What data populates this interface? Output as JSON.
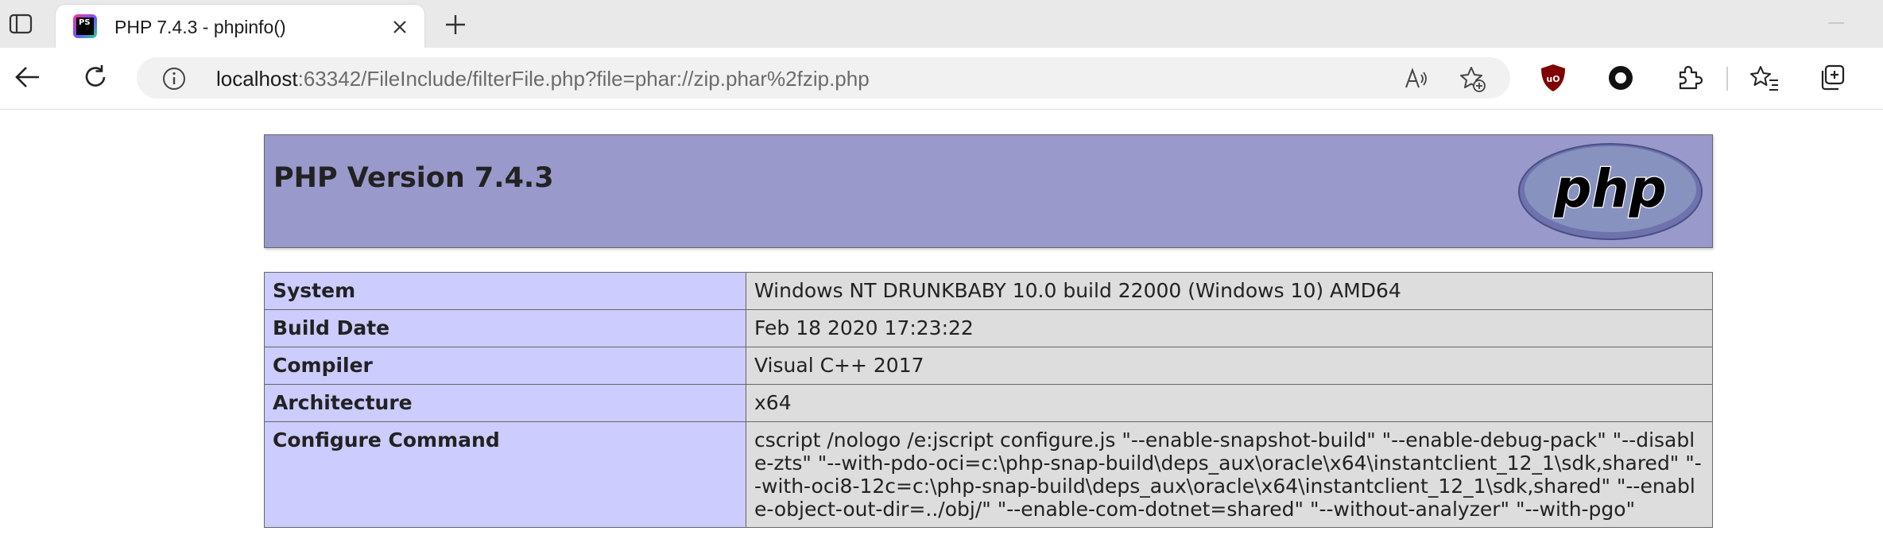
{
  "browser": {
    "tab": {
      "title": "PHP 7.4.3 - phpinfo()",
      "favicon_text": "PS"
    },
    "address": {
      "host": "localhost",
      "rest": ":63342/FileInclude/filterFile.php?file=phar://zip.phar%2fzip.php"
    },
    "icons": [
      "tab-actions-icon",
      "close-icon",
      "plus-icon",
      "back-icon",
      "refresh-icon",
      "info-icon",
      "read-aloud-icon",
      "add-favorite-icon",
      "ublock-icon",
      "circle-extension-icon",
      "extensions-icon",
      "favorites-icon",
      "collections-icon"
    ]
  },
  "page": {
    "title": "PHP Version 7.4.3",
    "logo_text": "php",
    "rows": [
      {
        "label": "System",
        "value": "Windows NT DRUNKBABY 10.0 build 22000 (Windows 10) AMD64"
      },
      {
        "label": "Build Date",
        "value": "Feb 18 2020 17:23:22"
      },
      {
        "label": "Compiler",
        "value": "Visual C++ 2017"
      },
      {
        "label": "Architecture",
        "value": "x64"
      },
      {
        "label": "Configure Command",
        "value": "cscript /nologo /e:jscript configure.js \"--enable-snapshot-build\" \"--enable-debug-pack\" \"--disable-zts\" \"--with-pdo-oci=c:\\php-snap-build\\deps_aux\\oracle\\x64\\instantclient_12_1\\sdk,shared\" \"--with-oci8-12c=c:\\php-snap-build\\deps_aux\\oracle\\x64\\instantclient_12_1\\sdk,shared\" \"--enable-object-out-dir=../obj/\" \"--enable-com-dotnet=shared\" \"--without-analyzer\" \"--with-pgo\""
      }
    ],
    "colors": {
      "header_bg": "#9999cc",
      "label_bg": "#ccccff",
      "value_bg": "#dddddd",
      "border": "#666666"
    }
  }
}
